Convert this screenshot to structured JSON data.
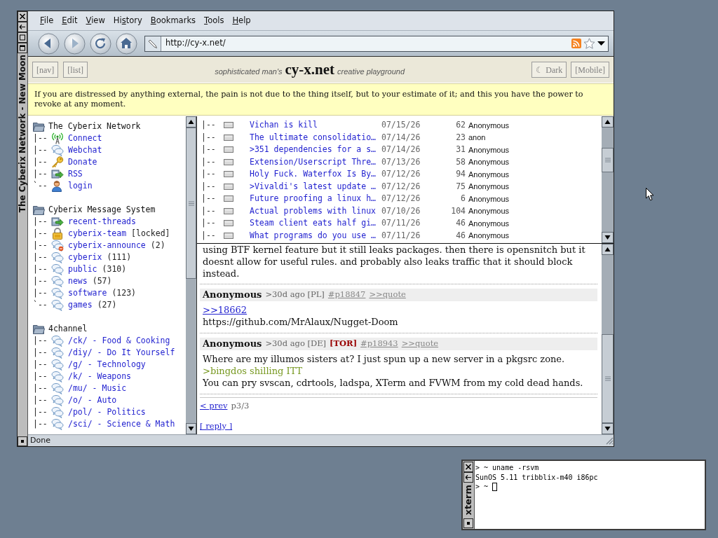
{
  "browser": {
    "title": "The Cyberix Network - New Moon",
    "menu": [
      {
        "key": "F",
        "post": "ile"
      },
      {
        "key": "E",
        "post": "dit"
      },
      {
        "key": "V",
        "post": "iew"
      },
      {
        "pre": "Hi",
        "key": "s",
        "post": "tory"
      },
      {
        "key": "B",
        "post": "ookmarks"
      },
      {
        "key": "T",
        "post": "ools"
      },
      {
        "key": "H",
        "post": "elp"
      }
    ],
    "navigation": [
      {
        "kind": "back",
        "disabled": false
      },
      {
        "kind": "forward",
        "disabled": true
      },
      {
        "kind": "reload",
        "disabled": false
      },
      {
        "kind": "home",
        "disabled": false
      }
    ],
    "url": "http://cy-x.net/",
    "page": {
      "header": {
        "left_buttons": [
          "[nav]",
          "[list]"
        ],
        "tagline_before": "sophisticated man's",
        "site_name": "cy-x.net",
        "tagline_after": "creative playground",
        "right_buttons": [
          "☾ Dark",
          "[Mobile]"
        ]
      },
      "quote": "If you are distressed by anything external, the pain is not due to the thing itself, but to your estimate of it; and this you have the power to revoke at any moment.",
      "sidebar": [
        {
          "title": "The Cyberix Network",
          "items": [
            {
              "branch": "|--",
              "kind": "connect",
              "label": "Connect"
            },
            {
              "branch": "|--",
              "kind": "chat",
              "label": "Webchat"
            },
            {
              "branch": "|--",
              "kind": "donate",
              "label": "Donate"
            },
            {
              "branch": "|--",
              "kind": "feed",
              "label": "RSS"
            },
            {
              "branch": "`--",
              "kind": "account",
              "label": "login"
            }
          ]
        },
        {
          "title": "Cyberix Message System",
          "items": [
            {
              "branch": "|--",
              "kind": "feed",
              "label": "recent-threads"
            },
            {
              "branch": "|--",
              "kind": "locked",
              "label": "cyberix-team",
              "suffix": "[locked]"
            },
            {
              "branch": "|--",
              "kind": "announce",
              "label": "cyberix-announce",
              "suffix": "(2)"
            },
            {
              "branch": "|--",
              "kind": "chat",
              "label": "cyberix",
              "suffix": "(111)"
            },
            {
              "branch": "|--",
              "kind": "chat",
              "label": "public",
              "suffix": "(310)"
            },
            {
              "branch": "|--",
              "kind": "chat",
              "label": "news",
              "suffix": "(57)"
            },
            {
              "branch": "|--",
              "kind": "chat",
              "label": "software",
              "suffix": "(123)"
            },
            {
              "branch": "`--",
              "kind": "chat",
              "label": "games",
              "suffix": "(27)"
            }
          ]
        },
        {
          "title": "4channel",
          "items": [
            {
              "branch": "|--",
              "kind": "chat",
              "label": "/ck/ - Food & Cooking"
            },
            {
              "branch": "|--",
              "kind": "chat",
              "label": "/diy/ - Do It Yourself"
            },
            {
              "branch": "|--",
              "kind": "chat",
              "label": "/g/ - Technology"
            },
            {
              "branch": "|--",
              "kind": "chat",
              "label": "/k/ - Weapons"
            },
            {
              "branch": "|--",
              "kind": "chat",
              "label": "/mu/ - Music"
            },
            {
              "branch": "|--",
              "kind": "chat",
              "label": "/o/ - Auto"
            },
            {
              "branch": "|--",
              "kind": "chat",
              "label": "/pol/ - Politics"
            },
            {
              "branch": "|--",
              "kind": "chat",
              "label": "/sci/ - Science & Math"
            }
          ]
        }
      ],
      "threads": [
        {
          "branch": "|--",
          "title": "Vichan is kill",
          "date": "07/15/26",
          "replies": "62",
          "author": "Anonymous"
        },
        {
          "branch": "|--",
          "title": "The ultimate consolidatio…",
          "date": "07/14/26",
          "replies": "23",
          "author": "anon"
        },
        {
          "branch": "|--",
          "title": ">351 dependencies for a s…",
          "date": "07/14/26",
          "replies": "31",
          "author": "Anonymous"
        },
        {
          "branch": "|--",
          "title": "Extension/Userscript Thre…",
          "date": "07/13/26",
          "replies": "58",
          "author": "Anonymous"
        },
        {
          "branch": "|--",
          "title": "Holy Fuck. Waterfox Is By…",
          "date": "07/12/26",
          "replies": "94",
          "author": "Anonymous"
        },
        {
          "branch": "|--",
          "title": ">Vivaldi's latest update …",
          "date": "07/12/26",
          "replies": "75",
          "author": "Anonymous"
        },
        {
          "branch": "|--",
          "title": "Future proofing a linux h…",
          "date": "07/12/26",
          "replies": "6",
          "author": "Anonymous"
        },
        {
          "branch": "|--",
          "title": "Actual problems with linux",
          "date": "07/10/26",
          "replies": "104",
          "author": "Anonymous"
        },
        {
          "branch": "|--",
          "title": "Steam client eats half gi…",
          "date": "07/11/26",
          "replies": "46",
          "author": "Anonymous"
        },
        {
          "branch": "|--",
          "title": "What programs do you use …",
          "date": "07/11/26",
          "replies": "46",
          "author": "Anonymous"
        }
      ],
      "thread_view": {
        "continued_text": "using BTF kernel feature but it still leaks packages. then there is opensnitch but it doesnt allow for useful rules. and probably also leaks traffic that it should block instead.",
        "posts": [
          {
            "author": "Anonymous",
            "meta": ">30d ago [PL]",
            "post_id": "#p18847",
            "quote_link": ">>quote",
            "body": [
              {
                "kind": "reply_link",
                "text": ">>18662"
              },
              {
                "kind": "text",
                "text": "https://github.com/MrAlaux/Nugget-Doom"
              }
            ]
          },
          {
            "author": "Anonymous",
            "meta": ">30d ago [DE]",
            "tag": "[TOR]",
            "post_id": "#p18943",
            "quote_link": ">>quote",
            "body": [
              {
                "kind": "text",
                "text": "Where are my illumos sisters at? I just spun up a new server in a pkgsrc zone."
              },
              {
                "kind": "greentext",
                "text": ">bingdos shilling ITT"
              },
              {
                "kind": "text",
                "text": "You can pry svscan, cdrtools, ladspa, XTerm and FVWM from my cold dead hands."
              }
            ]
          }
        ],
        "prev_link": "< prev",
        "page": "p3/3",
        "reply_link": "[ reply ]"
      }
    },
    "status": "Done"
  },
  "xterm": {
    "title": "xterm",
    "lines": [
      {
        "text": "> ~ uname -rsvm",
        "cursor": false
      },
      {
        "text": "SunOS 5.11 tribblix-m40 i86pc",
        "cursor": false
      },
      {
        "text": "> ~",
        "cursor": true
      }
    ]
  }
}
